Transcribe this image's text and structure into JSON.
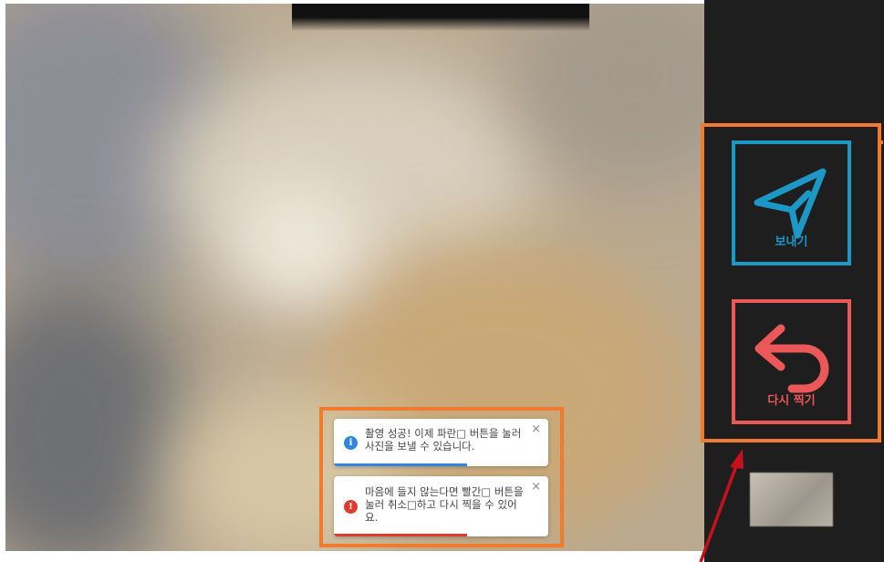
{
  "camera": {
    "send_button_label": "보내기",
    "retake_button_label": "다시 찍기"
  },
  "toasts": [
    {
      "type": "info",
      "icon": "info-icon",
      "message": "촬영 성공! 이제 파란□ 버튼을 눌러 사진을 보낼 수 있습니다.",
      "close": "×",
      "progress": 0.62
    },
    {
      "type": "error",
      "icon": "error-icon",
      "message": "마음에 들지 않는다면 빨간□ 버튼을 눌러 취소□하고 다시 찍을 수 있어요.",
      "close": "×",
      "progress": 0.62
    }
  ],
  "colors": {
    "send_accent": "#1c98c6",
    "retake_accent": "#ec5757",
    "highlight": "#f07a2e",
    "annotation_arrow": "#c8101c",
    "info": "#2e86de",
    "error": "#e03b2f"
  }
}
